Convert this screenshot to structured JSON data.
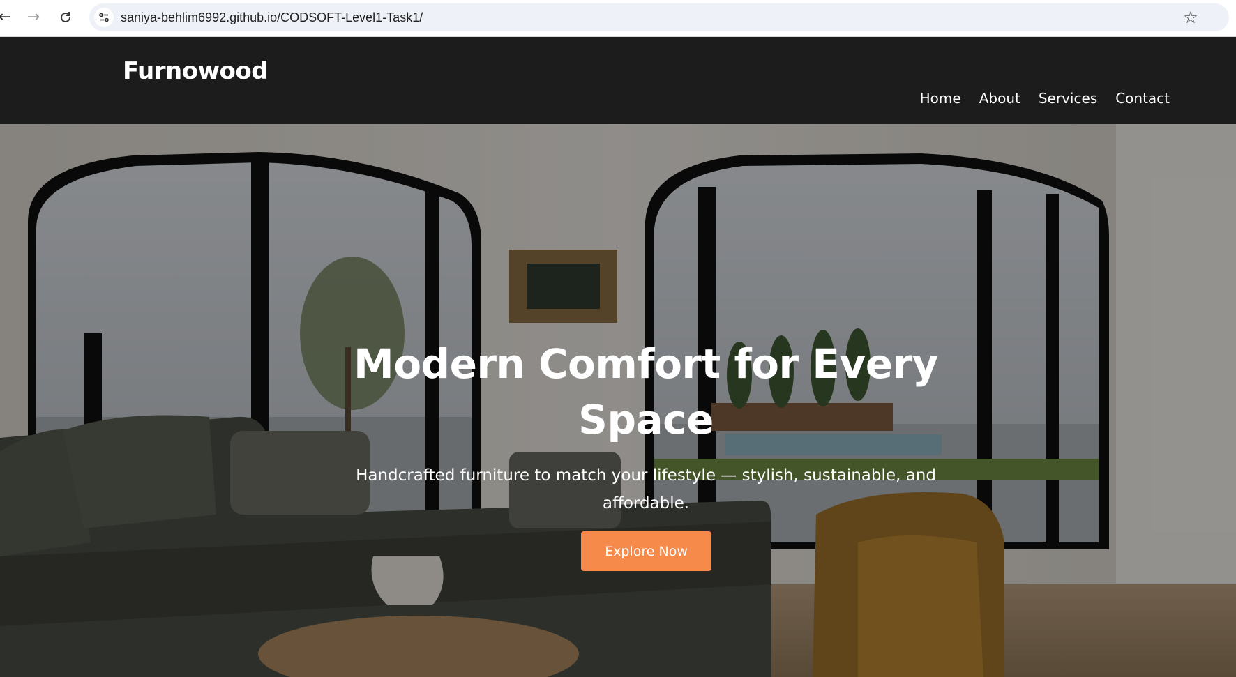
{
  "browser": {
    "url": "saniya-behlim6992.github.io/CODSOFT-Level1-Task1/",
    "icons": [
      "back-arrow-icon",
      "forward-arrow-icon",
      "reload-icon",
      "site-info-icon",
      "bookmark-star-icon"
    ]
  },
  "header": {
    "logo": "Furnowood",
    "nav": [
      {
        "label": "Home"
      },
      {
        "label": "About"
      },
      {
        "label": "Services"
      },
      {
        "label": "Contact"
      }
    ]
  },
  "hero": {
    "title": "Modern Comfort for Every Space",
    "subtitle": "Handcrafted furniture to match your lifestyle — stylish, sustainable, and affordable.",
    "cta_label": "Explore Now",
    "colors": {
      "cta": "#f58a4b",
      "header_bg": "#1c1c1c"
    }
  }
}
